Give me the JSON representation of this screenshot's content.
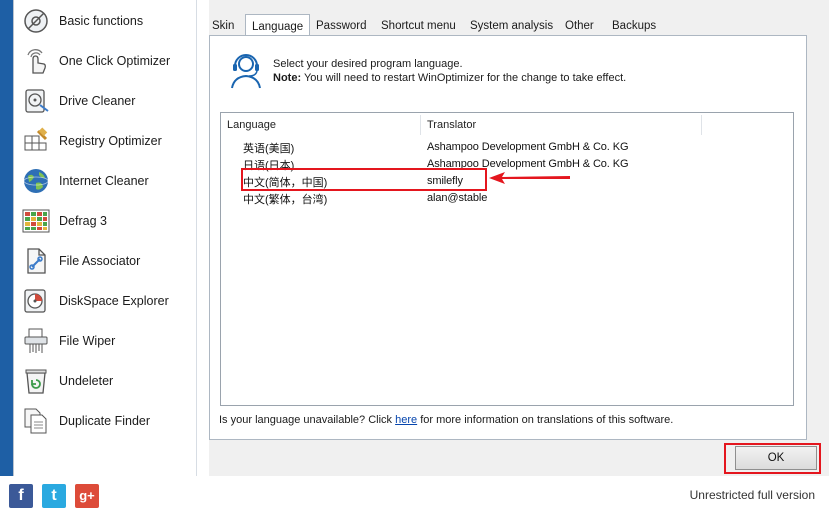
{
  "sidebar": {
    "items": [
      {
        "label": "Basic functions",
        "icon": "basic-functions-icon"
      },
      {
        "label": "One Click Optimizer",
        "icon": "one-click-optimizer-icon"
      },
      {
        "label": "Drive Cleaner",
        "icon": "drive-cleaner-icon"
      },
      {
        "label": "Registry Optimizer",
        "icon": "registry-optimizer-icon"
      },
      {
        "label": "Internet Cleaner",
        "icon": "internet-cleaner-icon"
      },
      {
        "label": "Defrag 3",
        "icon": "defrag-icon"
      },
      {
        "label": "File Associator",
        "icon": "file-associator-icon"
      },
      {
        "label": "DiskSpace Explorer",
        "icon": "diskspace-explorer-icon"
      },
      {
        "label": "File Wiper",
        "icon": "file-wiper-icon"
      },
      {
        "label": "Undeleter",
        "icon": "undeleter-icon"
      },
      {
        "label": "Duplicate Finder",
        "icon": "duplicate-finder-icon"
      }
    ]
  },
  "tabs": [
    "Skin",
    "Language",
    "Password",
    "Shortcut menu",
    "System analysis",
    "Other",
    "Backups"
  ],
  "active_tab": "Language",
  "info": {
    "line1": "Select your desired program language.",
    "note_label": "Note:",
    "note_text": " You will need to restart WinOptimizer for the change to take effect."
  },
  "list": {
    "columns": [
      "Language",
      "Translator"
    ],
    "rows": [
      {
        "language": "英语(美国)",
        "translator": "Ashampoo Development GmbH & Co. KG"
      },
      {
        "language": "日语(日本)",
        "translator": "Ashampoo Development GmbH & Co. KG"
      },
      {
        "language": "中文(简体，中国)",
        "translator": "smilefly"
      },
      {
        "language": "中文(繁体，台湾)",
        "translator": "alan@stable"
      }
    ]
  },
  "footer": {
    "before": "Is your language unavailable? Click ",
    "link": "here",
    "after": " for more information on translations of this software."
  },
  "ok_label": "OK",
  "version_text": "Unrestricted full version",
  "social": {
    "facebook": "f",
    "twitter": "t",
    "google": "g+"
  },
  "colors": {
    "highlight": "#e4161e",
    "frame": "#1e5fa5",
    "link": "#0645ad"
  }
}
